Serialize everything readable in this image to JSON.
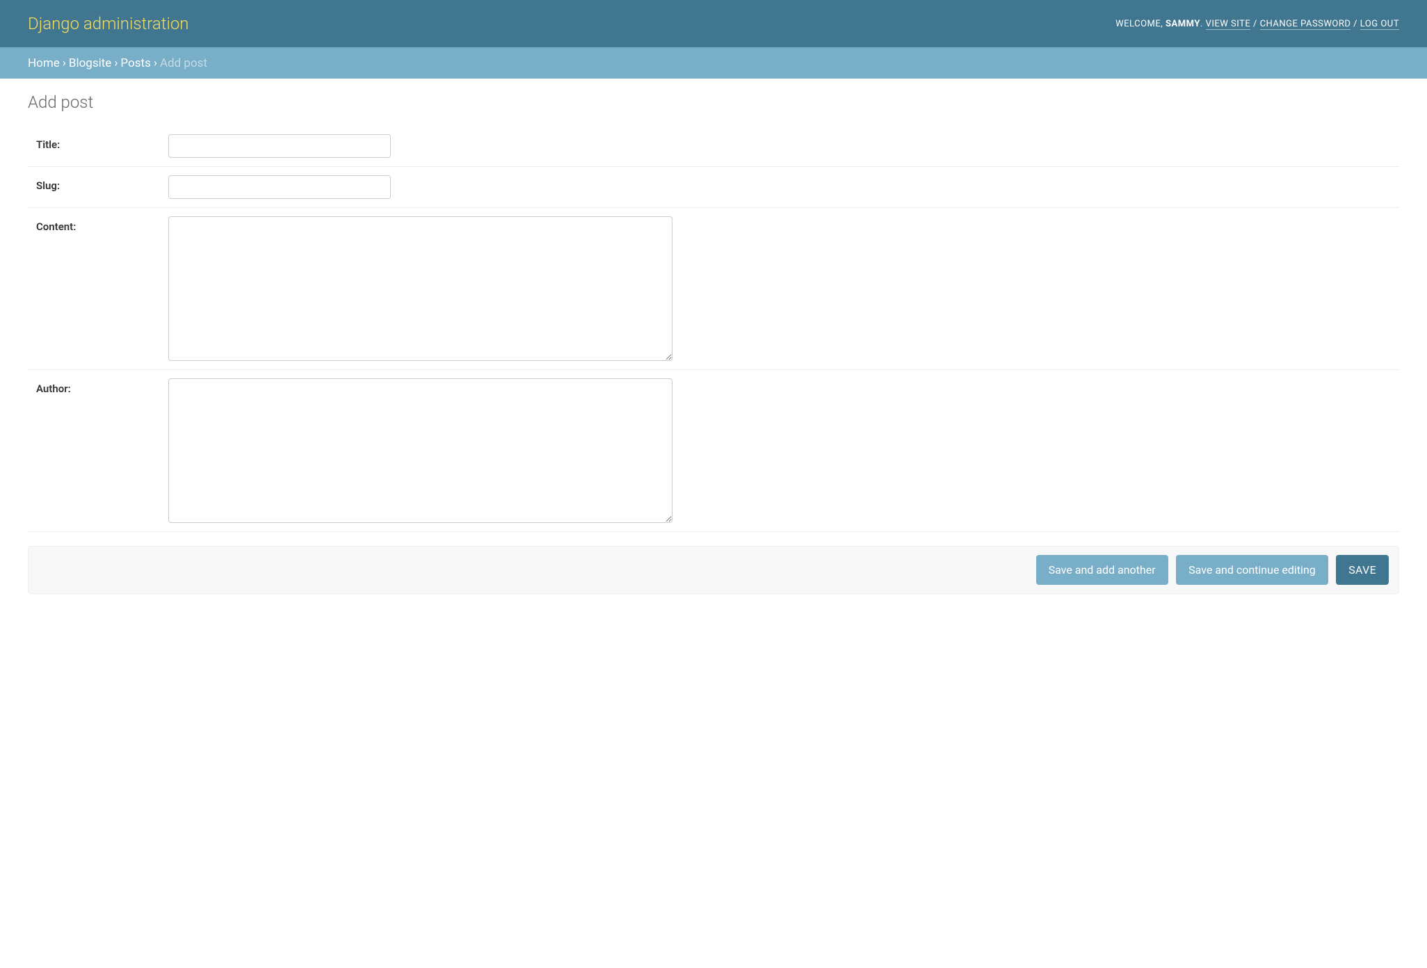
{
  "header": {
    "branding": "Django administration",
    "welcome": "WELCOME, ",
    "username": "SAMMY",
    "dot": ". ",
    "view_site": "VIEW SITE",
    "sep": " / ",
    "change_password": "CHANGE PASSWORD",
    "log_out": "LOG OUT"
  },
  "breadcrumbs": {
    "home": "Home",
    "app": "Blogsite",
    "model": "Posts",
    "current": "Add post",
    "sep": "›"
  },
  "page": {
    "title": "Add post"
  },
  "form": {
    "title": {
      "label": "Title:",
      "value": ""
    },
    "slug": {
      "label": "Slug:",
      "value": ""
    },
    "content": {
      "label": "Content:",
      "value": ""
    },
    "author": {
      "label": "Author:",
      "value": ""
    }
  },
  "buttons": {
    "save_add_another": "Save and add another",
    "save_continue": "Save and continue editing",
    "save": "SAVE"
  }
}
